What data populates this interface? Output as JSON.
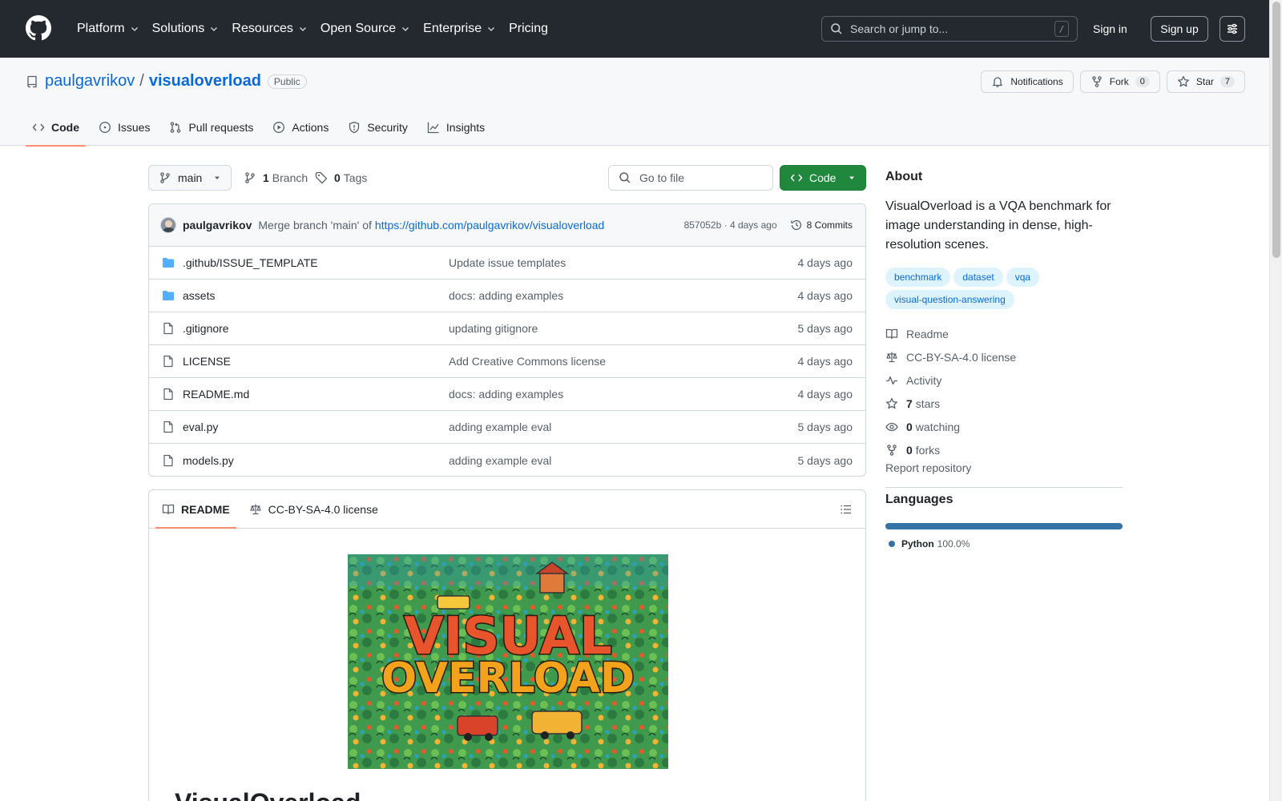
{
  "header": {
    "nav": [
      {
        "label": "Platform",
        "has_menu": true
      },
      {
        "label": "Solutions",
        "has_menu": true
      },
      {
        "label": "Resources",
        "has_menu": true
      },
      {
        "label": "Open Source",
        "has_menu": true
      },
      {
        "label": "Enterprise",
        "has_menu": true
      },
      {
        "label": "Pricing",
        "has_menu": false
      }
    ],
    "search_placeholder": "Search or jump to...",
    "search_shortcut": "/",
    "sign_in": "Sign in",
    "sign_up": "Sign up"
  },
  "repo": {
    "owner": "paulgavrikov",
    "separator": "/",
    "name": "visualoverload",
    "visibility": "Public",
    "actions": {
      "notifications": "Notifications",
      "fork": "Fork",
      "fork_count": "0",
      "star": "Star",
      "star_count": "7"
    },
    "tabs": [
      "Code",
      "Issues",
      "Pull requests",
      "Actions",
      "Security",
      "Insights"
    ],
    "active_tab": "Code"
  },
  "toolbar": {
    "branch": "main",
    "branch_count": "1",
    "branch_label": "Branch",
    "tag_count": "0",
    "tag_label": "Tags",
    "go_to_file": "Go to file",
    "code_button": "Code"
  },
  "commit": {
    "author": "paulgavrikov",
    "message": "Merge branch 'main' of",
    "message_link": "https://github.com/paulgavrikov/visualoverload",
    "hash_time": "857052b · 4 days ago",
    "commits": "8 Commits"
  },
  "files": [
    {
      "type": "folder",
      "name": ".github/ISSUE_TEMPLATE",
      "message": "Update issue templates",
      "date": "4 days ago"
    },
    {
      "type": "folder",
      "name": "assets",
      "message": "docs: adding examples",
      "date": "4 days ago"
    },
    {
      "type": "file",
      "name": ".gitignore",
      "message": "updating gitignore",
      "date": "5 days ago"
    },
    {
      "type": "file",
      "name": "LICENSE",
      "message": "Add Creative Commons license",
      "date": "4 days ago"
    },
    {
      "type": "file",
      "name": "README.md",
      "message": "docs: adding examples",
      "date": "4 days ago"
    },
    {
      "type": "file",
      "name": "eval.py",
      "message": "adding example eval",
      "date": "5 days ago"
    },
    {
      "type": "file",
      "name": "models.py",
      "message": "adding example eval",
      "date": "5 days ago"
    }
  ],
  "readme": {
    "tabs": [
      "README",
      "CC-BY-SA-4.0 license"
    ],
    "banner_line1": "VISUAL",
    "banner_line2": "OVERLOAD",
    "heading": "VisualOverload"
  },
  "about": {
    "title": "About",
    "description": "VisualOverload is a VQA benchmark for image understanding in dense, high-resolution scenes.",
    "topics": [
      "benchmark",
      "dataset",
      "vqa",
      "visual-question-answering"
    ],
    "links": {
      "readme": "Readme",
      "license": "CC-BY-SA-4.0 license",
      "activity": "Activity",
      "stars_count": "7",
      "stars_label": "stars",
      "watching_count": "0",
      "watching_label": "watching",
      "forks_count": "0",
      "forks_label": "forks"
    },
    "report": "Report repository"
  },
  "languages": {
    "title": "Languages",
    "items": [
      {
        "name": "Python",
        "percent": "100.0%",
        "color": "#3572A5"
      }
    ]
  },
  "colors": {
    "header_bg": "#24292f",
    "link": "#0969da",
    "primary_button": "#1f883d",
    "active_tab_underline": "#fd8c73",
    "folder_icon": "#54aeff"
  }
}
